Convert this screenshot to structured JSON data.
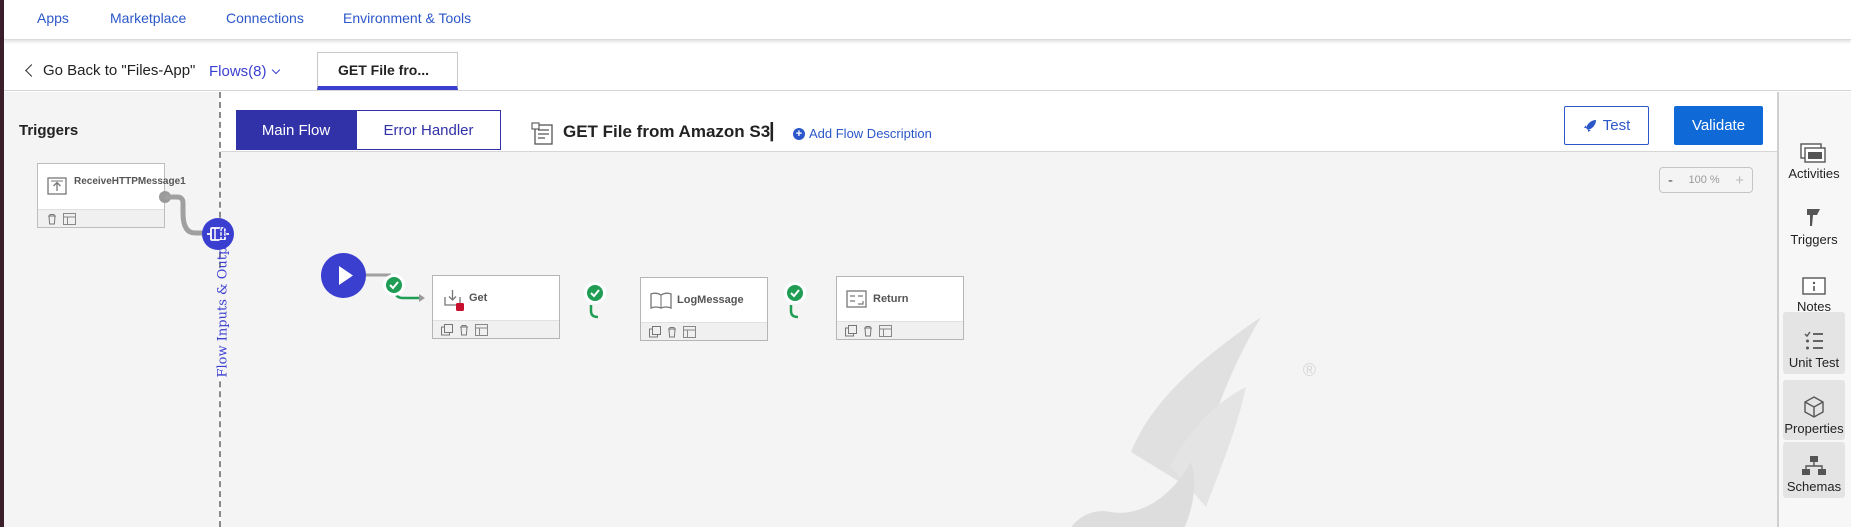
{
  "top_nav": {
    "items": [
      "Apps",
      "Marketplace",
      "Connections",
      "Environment & Tools"
    ]
  },
  "tab_bar": {
    "back_label": "Go Back to \"Files-App\"",
    "flows_label": "Flows(8)",
    "active_tab_label": "GET File fro..."
  },
  "triggers": {
    "title": "Triggers",
    "card_label": "ReceiveHTTPMessage1"
  },
  "flow_io_label": "Flow Inputs & Outputs",
  "canvas": {
    "main_flow_label": "Main Flow",
    "error_handler_label": "Error Handler",
    "flow_title": "GET File from Amazon S3",
    "title_separator": "|",
    "add_description_label": "Add Flow Description",
    "test_label": "Test",
    "validate_label": "Validate",
    "zoom_minus": "-",
    "zoom_level": "100 %",
    "zoom_plus": "+",
    "activities": [
      {
        "name": "Get"
      },
      {
        "name": "LogMessage"
      },
      {
        "name": "Return"
      }
    ],
    "watermark_mark": "®"
  },
  "right_sidebar": {
    "items": [
      "Activities",
      "Triggers",
      "Notes",
      "Unit Test",
      "Properties",
      "Schemas"
    ]
  },
  "colors": {
    "accent": "#3b3fd0",
    "link": "#2b57c9",
    "primary_button": "#0f6ad8",
    "success": "#1f9d55",
    "error_icon": "#c8102e"
  }
}
